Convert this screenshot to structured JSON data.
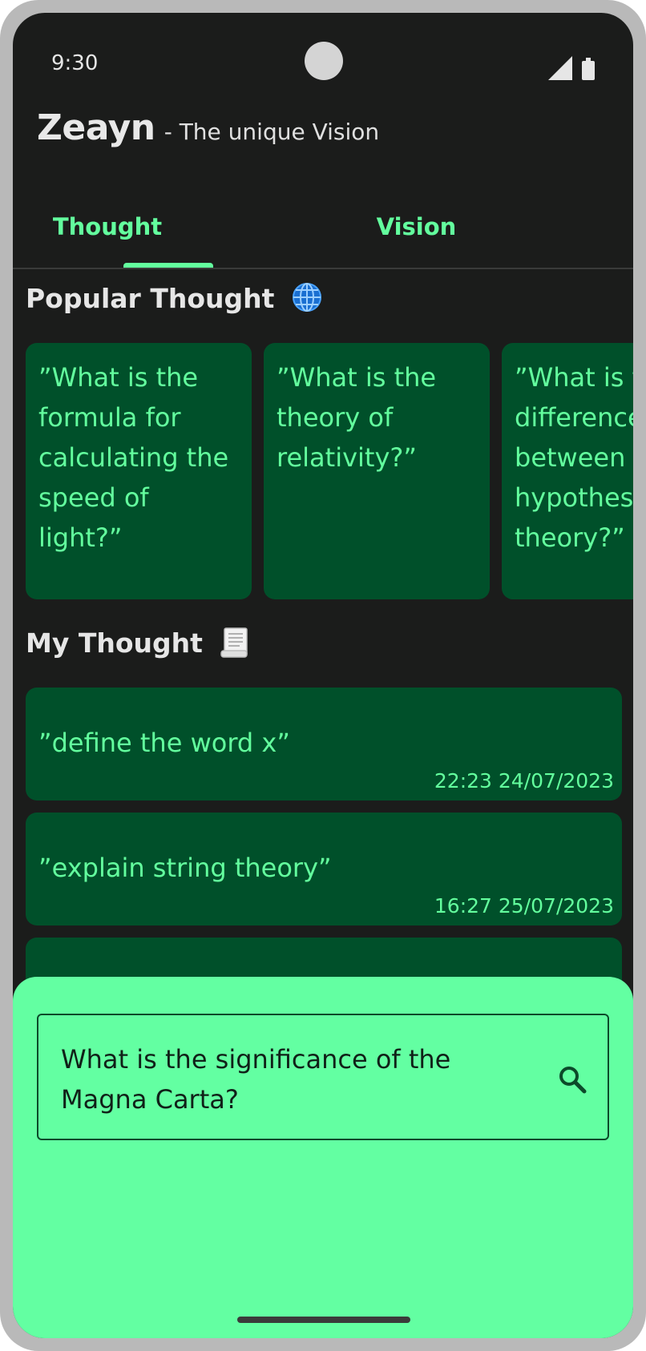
{
  "status_bar": {
    "time": "9:30"
  },
  "header": {
    "app_name": "Zeayn",
    "tagline": "- The unique Vision"
  },
  "tabs": [
    {
      "label": "Thought",
      "selected": true
    },
    {
      "label": "Vision",
      "selected": false
    }
  ],
  "popular": {
    "title": "Popular Thought",
    "icon": "globe-icon",
    "cards": [
      {
        "text": "”What is the formula for calculating the speed of light?”"
      },
      {
        "text": "”What is the theory of relativity?”"
      },
      {
        "text": "”What is the difference between a hypothesis and a theory?”"
      }
    ]
  },
  "mine": {
    "title": "My Thought",
    "icon": "scroll-icon",
    "items": [
      {
        "text": "”define the word x”",
        "time": "22:23 24/07/2023"
      },
      {
        "text": "”explain string theory”",
        "time": "16:27 25/07/2023"
      }
    ]
  },
  "search": {
    "value": "What is the significance of the Magna Carta?"
  },
  "colors": {
    "background": "#1b1c1b",
    "accent": "#63ff9e",
    "card": "#00502a",
    "sheet": "#63ffa2"
  }
}
